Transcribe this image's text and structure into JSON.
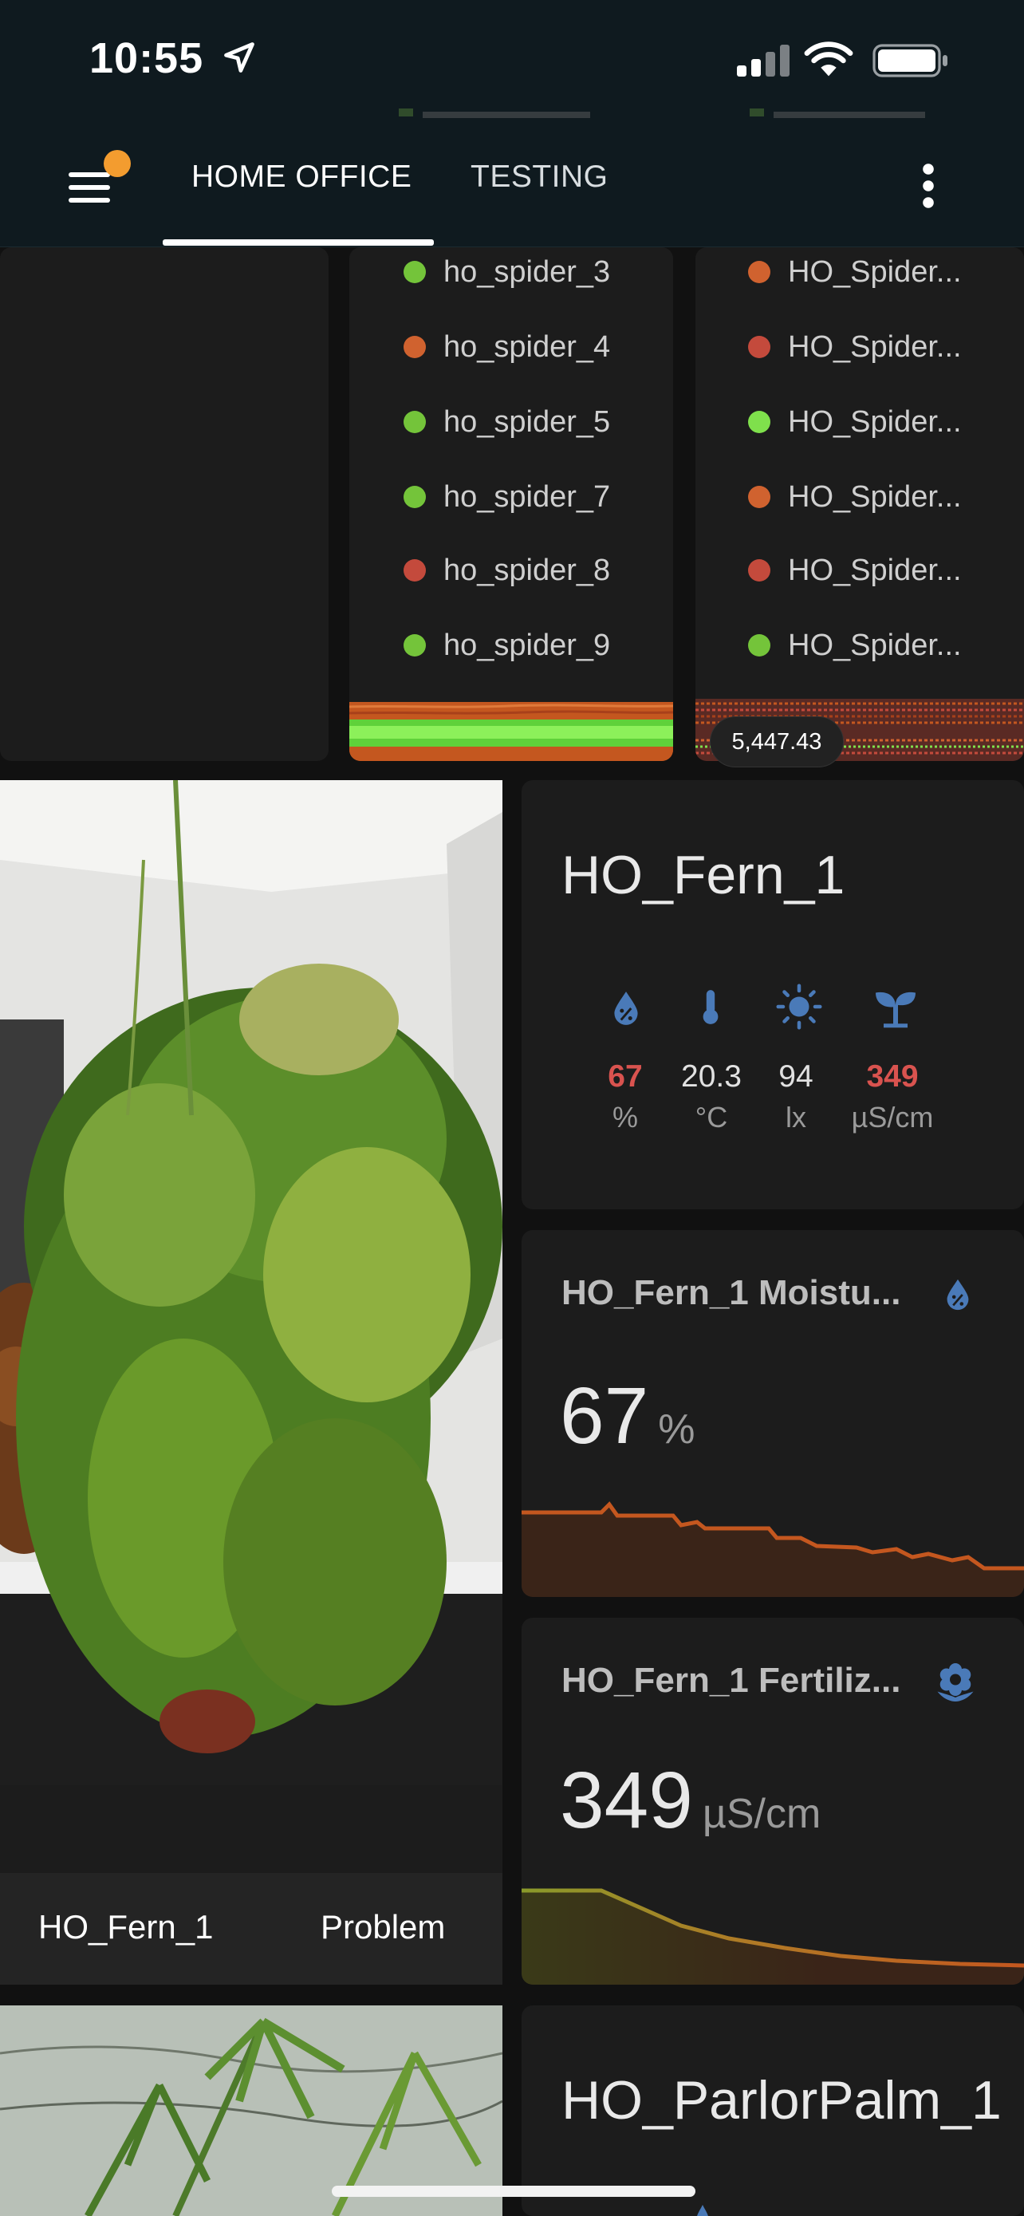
{
  "status_bar": {
    "time": "10:55"
  },
  "header": {
    "tabs": [
      {
        "label": "HOME OFFICE"
      },
      {
        "label": "TESTING"
      }
    ]
  },
  "spider_list_left": [
    {
      "label": "ho_spider_3",
      "color": "#74c43a"
    },
    {
      "label": "ho_spider_4",
      "color": "#d0622f"
    },
    {
      "label": "ho_spider_5",
      "color": "#74c43a"
    },
    {
      "label": "ho_spider_7",
      "color": "#74c43a"
    },
    {
      "label": "ho_spider_8",
      "color": "#c44a3c"
    },
    {
      "label": "ho_spider_9",
      "color": "#74c43a"
    }
  ],
  "spider_list_right": [
    {
      "label": "HO_Spider...",
      "color": "#d0622f"
    },
    {
      "label": "HO_Spider...",
      "color": "#c44a3c"
    },
    {
      "label": "HO_Spider...",
      "color": "#7fe04c"
    },
    {
      "label": "HO_Spider...",
      "color": "#d0622f"
    },
    {
      "label": "HO_Spider...",
      "color": "#c44a3c"
    },
    {
      "label": "HO_Spider...",
      "color": "#74c43a"
    }
  ],
  "history_tooltip": "5,447.43",
  "fern_photo": {
    "name": "HO_Fern_1",
    "status": "Problem"
  },
  "fern_card": {
    "title": "HO_Fern_1",
    "sensors": [
      {
        "icon": "moisture-icon",
        "value": "67",
        "unit": "%",
        "problem": true
      },
      {
        "icon": "thermometer-icon",
        "value": "20.3",
        "unit": "°C",
        "problem": false
      },
      {
        "icon": "sun-icon",
        "value": "94",
        "unit": "lx",
        "problem": false
      },
      {
        "icon": "sprout-icon",
        "value": "349",
        "unit": "µS/cm",
        "problem": true
      }
    ]
  },
  "moisture_card": {
    "title": "HO_Fern_1 Moistu...",
    "value": "67",
    "unit": "%"
  },
  "fertility_card": {
    "title": "HO_Fern_1 Fertiliz...",
    "value": "349",
    "unit": "µS/cm"
  },
  "parlor_card": {
    "title": "HO_ParlorPalm_1"
  },
  "colors": {
    "accent_blue": "#4a7ab8",
    "problem_red": "#d9534f",
    "trend_orange": "#c4571f",
    "trend_olive": "#8a9a2a",
    "menu_badge": "#f39c2f"
  }
}
